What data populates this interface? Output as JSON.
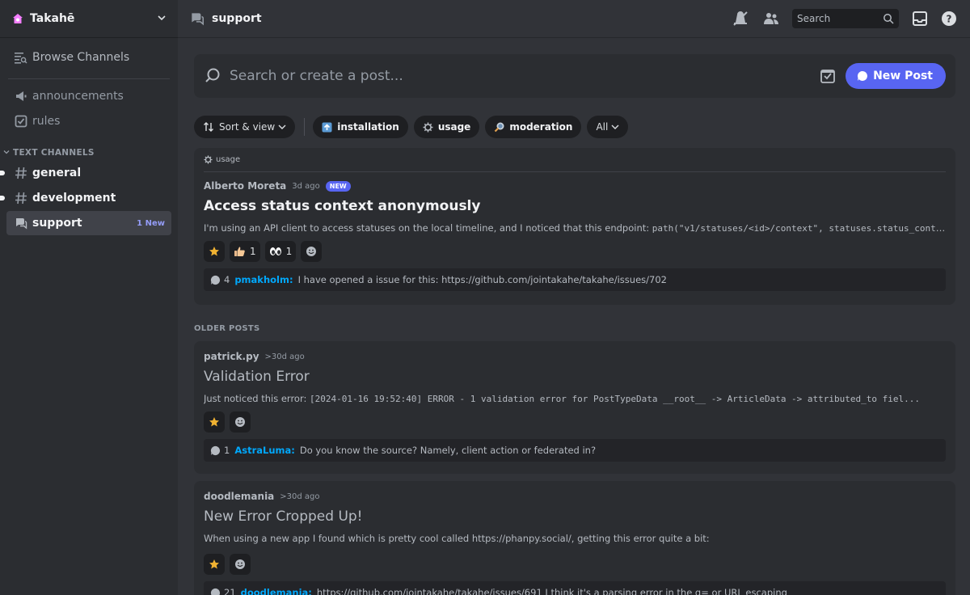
{
  "server": {
    "name": "Takahē"
  },
  "sidebar": {
    "browse_label": "Browse Channels",
    "top_channels": [
      {
        "name": "announcements"
      },
      {
        "name": "rules"
      }
    ],
    "category_label": "TEXT CHANNELS",
    "text_channels": [
      {
        "name": "general"
      },
      {
        "name": "development"
      },
      {
        "name": "support",
        "badge": "1 New"
      }
    ]
  },
  "topbar": {
    "channel_name": "support",
    "search_placeholder": "Search"
  },
  "forum": {
    "search_placeholder": "Search or create a post...",
    "new_post_label": "New Post",
    "sort_label": "Sort & view",
    "tags": [
      {
        "label": "installation"
      },
      {
        "label": "usage"
      },
      {
        "label": "moderation"
      }
    ],
    "all_label": "All",
    "older_label": "OLDER POSTS"
  },
  "posts": [
    {
      "tag": "usage",
      "author": "Alberto Moreta",
      "ago": "3d ago",
      "new_badge": "NEW",
      "title": "Access status context anonymously",
      "snippet_text": "I'm using an API client to access statuses on the local timeline, and I noticed that this endpoint: ",
      "snippet_code": "path(\"v1/statuses/<id>/context\", statuses.status_context...",
      "reactions": [
        {
          "emoji": "thumbs-up",
          "count": "1"
        },
        {
          "emoji": "eyes",
          "count": "1"
        }
      ],
      "reply_count": "4",
      "reply_user": "pmakholm:",
      "reply_text": "I have opened a issue for this: https://github.com/jointakahe/takahe/issues/702"
    },
    {
      "author": "patrick.py",
      "ago": ">30d ago",
      "title": "Validation Error",
      "snippet_text": "Just noticed this error: ",
      "snippet_code": "[2024-01-16 19:52:40] ERROR - 1 validation error for PostTypeData __root__ -> ArticleData -> attributed_to fiel...",
      "reply_count": "1",
      "reply_user": "AstraLuma:",
      "reply_text": "Do you know the source? Namely, client action or federated in?"
    },
    {
      "author": "doodlemania",
      "ago": ">30d ago",
      "title": "New Error Cropped Up!",
      "snippet_text": "When using a new app I found which is pretty cool called https://phanpy.social/, getting this error quite a bit:",
      "reply_count": "21",
      "reply_user": "doodlemania:",
      "reply_text": "https://github.com/jointakahe/takahe/issues/691 I think it's a parsing error in the q= or URL escaping"
    }
  ],
  "colors": {
    "accent": "#5865f2",
    "link": "#00a8fc",
    "star": "#f0b232"
  }
}
